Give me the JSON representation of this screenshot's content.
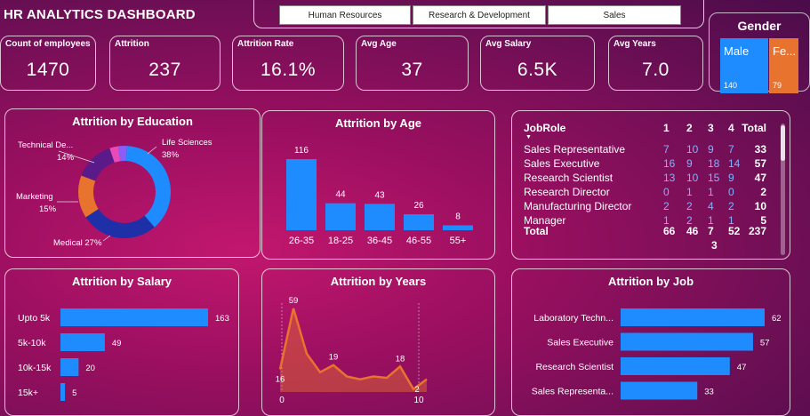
{
  "dashboard_title": "HR ANALYTICS DASHBOARD",
  "slicer": [
    "Human Resources",
    "Research & Development",
    "Sales"
  ],
  "kpis": [
    {
      "label": "Count of employees",
      "value": "1470"
    },
    {
      "label": "Attrition",
      "value": "237"
    },
    {
      "label": "Attrition Rate",
      "value": "16.1%"
    },
    {
      "label": "Avg Age",
      "value": "37"
    },
    {
      "label": "Avg Salary",
      "value": "6.5K"
    },
    {
      "label": "Avg Years",
      "value": "7.0"
    }
  ],
  "gender": {
    "title": "Gender",
    "male_label": "Male",
    "male_count": "140",
    "female_label": "Fe...",
    "female_count": "79"
  },
  "colors": {
    "blue": "#1e8bff",
    "orange": "#e8732e",
    "dark_blue": "#1f2fa8",
    "purple": "#6a1a9e",
    "pink": "#e84bb8",
    "violet": "#8b5cf6"
  },
  "chart_data": [
    {
      "type": "pie",
      "title": "Attrition by Education",
      "slices": [
        {
          "label": "Life Sciences",
          "display": "Life Sciences",
          "pct_label": "38%",
          "value": 38,
          "color": "#1e8bff"
        },
        {
          "label": "Medical",
          "display": "Medical 27%",
          "pct_label": "",
          "value": 27,
          "color": "#1f2fa8"
        },
        {
          "label": "Marketing",
          "display": "Marketing",
          "pct_label": "15%",
          "value": 15,
          "color": "#e8732e"
        },
        {
          "label": "Technical Degree",
          "display": "Technical De...",
          "pct_label": "14%",
          "value": 14,
          "color": "#5a1a8a"
        },
        {
          "label": "Other",
          "display": "",
          "pct_label": "",
          "value": 3,
          "color": "#e84bb8"
        },
        {
          "label": "Human Resources",
          "display": "",
          "pct_label": "",
          "value": 3,
          "color": "#8b5cf6"
        }
      ]
    },
    {
      "type": "bar",
      "title": "Attrition by Age",
      "categories": [
        "26-35",
        "18-25",
        "36-45",
        "46-55",
        "55+"
      ],
      "values": [
        116,
        44,
        43,
        26,
        8
      ]
    },
    {
      "type": "table",
      "title": "JobRole matrix",
      "columns": [
        "JobRole",
        "1",
        "2",
        "3",
        "4",
        "Total"
      ],
      "rows": [
        [
          "Sales Representative",
          "7",
          "10",
          "9",
          "7",
          "33"
        ],
        [
          "Sales Executive",
          "16",
          "9",
          "18",
          "14",
          "57"
        ],
        [
          "Research Scientist",
          "13",
          "10",
          "15",
          "9",
          "47"
        ],
        [
          "Research Director",
          "0",
          "1",
          "1",
          "0",
          "2"
        ],
        [
          "Manufacturing Director",
          "2",
          "2",
          "4",
          "2",
          "10"
        ],
        [
          "Manager",
          "1",
          "2",
          "1",
          "1",
          "5"
        ]
      ],
      "total": [
        "Total",
        "66",
        "46",
        "7",
        "52",
        "237"
      ],
      "total_wrap": "3"
    },
    {
      "type": "bar",
      "title": "Attrition by Salary",
      "categories": [
        "Upto 5k",
        "5k-10k",
        "10k-15k",
        "15k+"
      ],
      "values": [
        163,
        49,
        20,
        5
      ]
    },
    {
      "type": "area",
      "title": "Attrition by Years",
      "x": [
        0,
        1,
        2,
        3,
        4,
        5,
        6,
        7,
        8,
        9,
        10,
        11
      ],
      "values": [
        16,
        59,
        27,
        14,
        19,
        11,
        9,
        11,
        10,
        18,
        2,
        9
      ],
      "labels_shown": {
        "0": "16",
        "1": "59",
        "4": "19",
        "9": "18",
        "10": "2"
      },
      "x_ticks": [
        "0",
        "10"
      ]
    },
    {
      "type": "bar",
      "title": "Attrition by Job",
      "categories": [
        "Laboratory Techn...",
        "Sales Executive",
        "Research Scientist",
        "Sales Representa..."
      ],
      "values": [
        62,
        57,
        47,
        33
      ]
    }
  ]
}
